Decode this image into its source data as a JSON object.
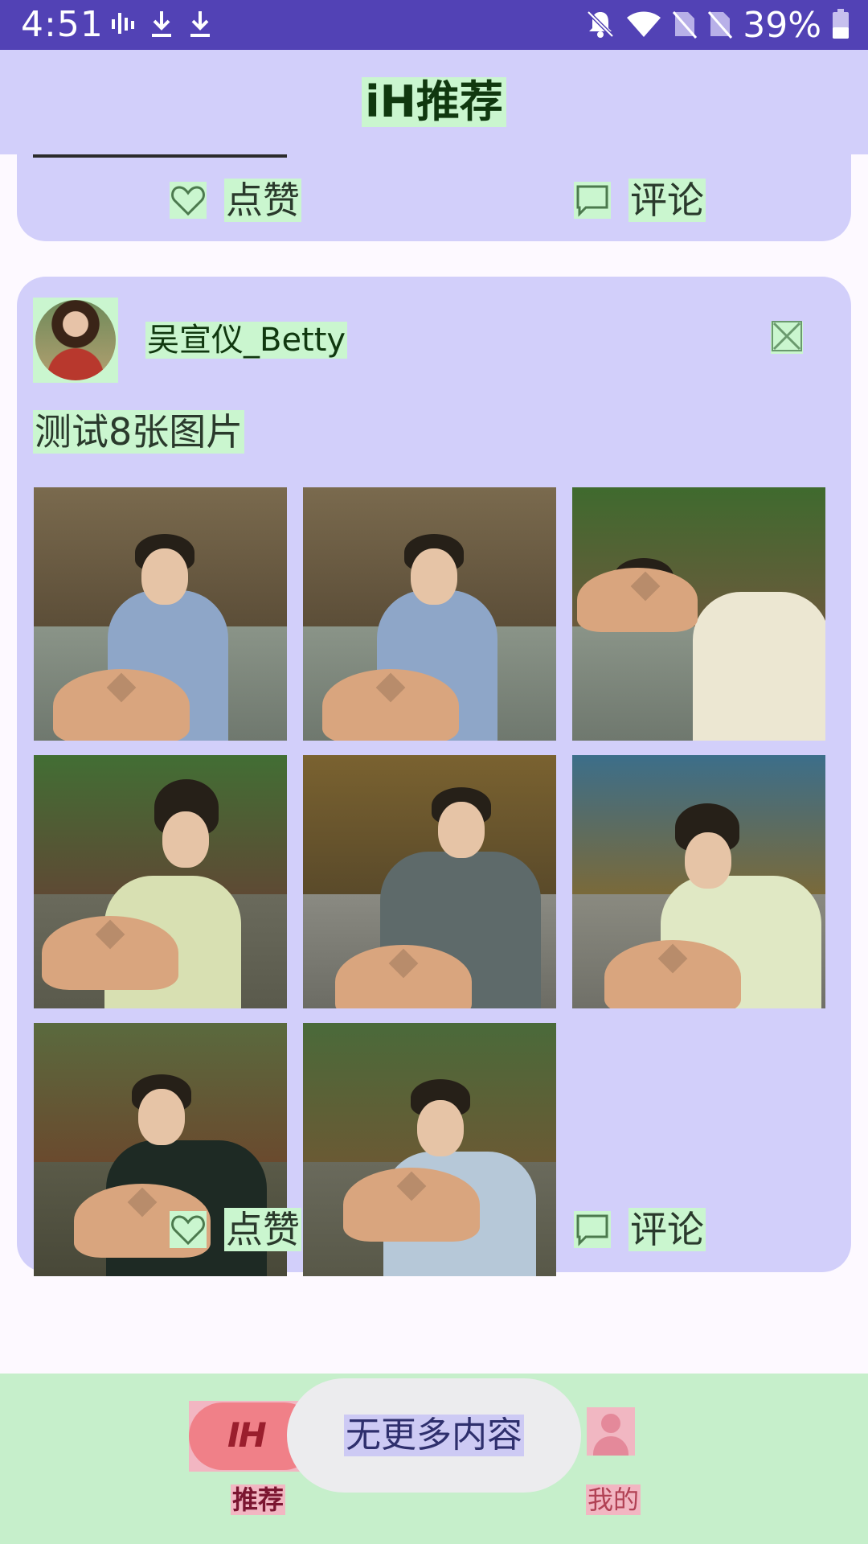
{
  "status_bar": {
    "time": "4:51",
    "battery_percent": "39%",
    "left_icons": [
      "signal-bars-icon",
      "download-icon",
      "download-icon"
    ],
    "right_icons": [
      "bell-off-icon",
      "wifi-icon",
      "no-sim-icon",
      "no-sim-icon",
      "battery-icon"
    ]
  },
  "app_bar": {
    "title": "iH推荐"
  },
  "feed": {
    "previous_post": {
      "like_label": "点赞",
      "comment_label": "评论"
    },
    "post": {
      "username": "吴宣仪_Betty",
      "text": "测试8张图片",
      "photo_count": 8,
      "like_label": "点赞",
      "comment_label": "评论"
    }
  },
  "bottom_nav": {
    "items": [
      {
        "label": "推荐",
        "icon": "ih-logo-icon",
        "selected": true
      },
      {
        "label": "我的",
        "icon": "profile-icon",
        "selected": false
      }
    ],
    "logo_text": "IH"
  },
  "toast": {
    "message": "无更多内容"
  },
  "colors": {
    "status_bar": "#5242b5",
    "card_bg": "#d2cffa",
    "highlight": "#caf6cf",
    "bottom_nav_bg": "#c6efcb",
    "nav_selected": "#f08088"
  }
}
